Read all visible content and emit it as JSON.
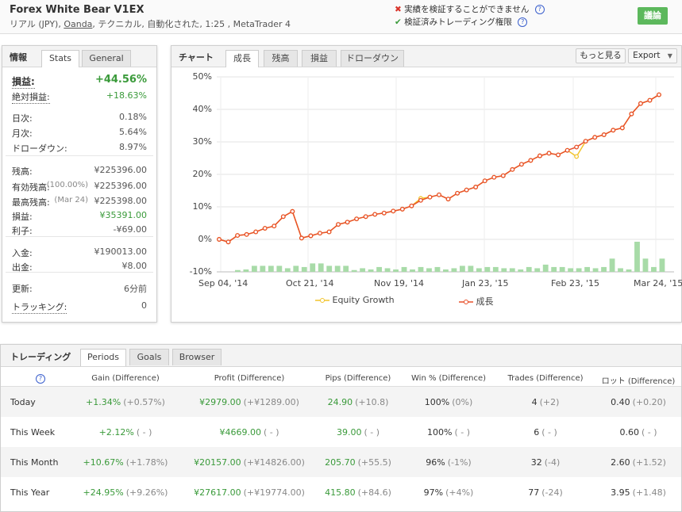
{
  "header": {
    "title": "Forex White Bear V1EX",
    "subtitle_prefix": "リアル (JPY), ",
    "broker_link": "Oanda",
    "subtitle_suffix": ", テクニカル, 自動化された, 1:25 , MetaTrader 4",
    "flag_unverified": "実績を検証することができません",
    "flag_verified": "検証済みトレーディング権限",
    "discuss_button": "議論"
  },
  "info_panel": {
    "title": "情報",
    "tabs": [
      "Stats",
      "General"
    ],
    "active_tab": "Stats",
    "stats": [
      {
        "label": "損益:",
        "value": "+44.56%"
      },
      {
        "label": "絶対損益:",
        "value": "+18.63%"
      },
      {
        "label": "日次:",
        "value": "0.18%"
      },
      {
        "label": "月次:",
        "value": "5.64%"
      },
      {
        "label": "ドローダウン:",
        "value": "8.97%"
      },
      {
        "label": "残高:",
        "value": "¥225396.00"
      },
      {
        "label": "有効残高:",
        "note": "(100.00%)",
        "value": "¥225396.00"
      },
      {
        "label": "最高残高:",
        "note": "(Mar 24)",
        "value": "¥225398.00"
      },
      {
        "label": "損益:",
        "value": "¥35391.00"
      },
      {
        "label": "利子:",
        "value": "-¥69.00"
      },
      {
        "label": "入金:",
        "value": "¥190013.00"
      },
      {
        "label": "出金:",
        "value": "¥8.00"
      },
      {
        "label": "更新:",
        "value": "6分前"
      },
      {
        "label": "トラッキング:",
        "value": "0"
      }
    ]
  },
  "chart_panel": {
    "title": "チャート",
    "tabs": [
      "成長",
      "残高",
      "損益",
      "ドローダウン"
    ],
    "active_tab": "成長",
    "more_button": "もっと見る",
    "export_button": "Export",
    "export_arrow": "▼"
  },
  "chart_data": {
    "type": "line",
    "title": "",
    "xlabel": "",
    "ylabel": "",
    "ylim": [
      -10,
      50
    ],
    "y_ticks": [
      "50%",
      "40%",
      "30%",
      "20%",
      "10%",
      "0%",
      "-10%"
    ],
    "x_ticks": [
      "Sep 04, '14",
      "Oct 21, '14",
      "Nov 19, '14",
      "Jan 23, '15",
      "Feb 23, '15",
      "Mar 24, '15"
    ],
    "grid": true,
    "legend": "bottom",
    "series": [
      {
        "name": "成長",
        "color": "#e8502a",
        "values": [
          0.0,
          -0.8,
          1.2,
          1.5,
          2.3,
          3.4,
          4.1,
          7.0,
          8.6,
          0.4,
          1.1,
          1.9,
          2.3,
          4.6,
          5.3,
          6.3,
          7.0,
          7.7,
          8.1,
          8.7,
          9.3,
          10.3,
          12.0,
          13.0,
          13.7,
          12.4,
          14.2,
          15.2,
          16.1,
          18.0,
          19.1,
          19.6,
          21.5,
          23.1,
          24.3,
          25.7,
          26.5,
          26.0,
          27.4,
          28.4,
          30.2,
          31.4,
          32.2,
          33.6,
          34.3,
          38.6,
          41.8,
          42.8,
          44.5
        ]
      },
      {
        "name": "Equity Growth",
        "color": "#f2c42b",
        "values": [
          0.0,
          -0.8,
          1.2,
          1.5,
          2.3,
          3.4,
          4.1,
          7.0,
          8.6,
          0.4,
          1.1,
          1.9,
          2.3,
          4.6,
          5.3,
          6.3,
          7.0,
          7.7,
          8.1,
          8.7,
          9.3,
          10.3,
          12.6,
          13.0,
          13.7,
          12.4,
          14.2,
          15.2,
          16.1,
          18.0,
          19.1,
          19.6,
          21.5,
          23.1,
          24.3,
          25.7,
          26.5,
          26.0,
          27.4,
          25.5,
          30.2,
          31.4,
          32.2,
          33.6,
          34.3,
          38.6,
          41.8,
          42.8,
          44.5
        ]
      }
    ],
    "bars": {
      "name": "Volume",
      "color": "#a8dba8",
      "values": [
        0.3,
        0.4,
        1.0,
        1.0,
        1.0,
        1.0,
        0.6,
        1.0,
        0.8,
        1.4,
        1.4,
        1.0,
        1.0,
        1.0,
        0.3,
        0.6,
        0.4,
        0.8,
        0.6,
        0.4,
        0.8,
        0.4,
        0.8,
        0.6,
        0.8,
        0.4,
        0.6,
        1.0,
        1.0,
        0.6,
        0.8,
        0.8,
        0.6,
        0.6,
        0.4,
        0.8,
        0.6,
        1.2,
        0.8,
        0.8,
        0.6,
        0.6,
        0.8,
        0.6,
        0.8,
        2.2,
        0.6,
        0.4,
        5.0,
        2.2,
        0.8,
        2.2
      ]
    }
  },
  "trading_panel": {
    "title": "トレーディング",
    "tabs": [
      "Periods",
      "Goals",
      "Browser"
    ],
    "active_tab": "Periods",
    "columns": [
      "Gain (Difference)",
      "Profit (Difference)",
      "Pips (Difference)",
      "Win % (Difference)",
      "Trades (Difference)",
      "ロット (Difference)"
    ],
    "rows": [
      {
        "period": "Today",
        "gain": "+1.34%",
        "gain_diff": "(+0.57%)",
        "profit": "¥2979.00",
        "profit_diff": "(+¥1289.00)",
        "pips": "24.90",
        "pips_diff": "(+10.8)",
        "win": "100%",
        "win_diff": "(0%)",
        "trades": "4",
        "trades_diff": "(+2)",
        "lots": "0.40",
        "lots_diff": "(+0.20)"
      },
      {
        "period": "This Week",
        "gain": "+2.12%",
        "gain_diff": "( - )",
        "profit": "¥4669.00",
        "profit_diff": "( - )",
        "pips": "39.00",
        "pips_diff": "( - )",
        "win": "100%",
        "win_diff": "( - )",
        "trades": "6",
        "trades_diff": "( - )",
        "lots": "0.60",
        "lots_diff": "( - )"
      },
      {
        "period": "This Month",
        "gain": "+10.67%",
        "gain_diff": "(+1.78%)",
        "profit": "¥20157.00",
        "profit_diff": "(+¥14826.00)",
        "pips": "205.70",
        "pips_diff": "(+55.5)",
        "win": "96%",
        "win_diff": "(-1%)",
        "trades": "32",
        "trades_diff": "(-4)",
        "lots": "2.60",
        "lots_diff": "(+1.52)"
      },
      {
        "period": "This Year",
        "gain": "+24.95%",
        "gain_diff": "(+9.26%)",
        "profit": "¥27617.00",
        "profit_diff": "(+¥19774.00)",
        "pips": "415.80",
        "pips_diff": "(+84.6)",
        "win": "97%",
        "win_diff": "(+4%)",
        "trades": "77",
        "trades_diff": "(-24)",
        "lots": "3.95",
        "lots_diff": "(+1.48)"
      }
    ]
  }
}
